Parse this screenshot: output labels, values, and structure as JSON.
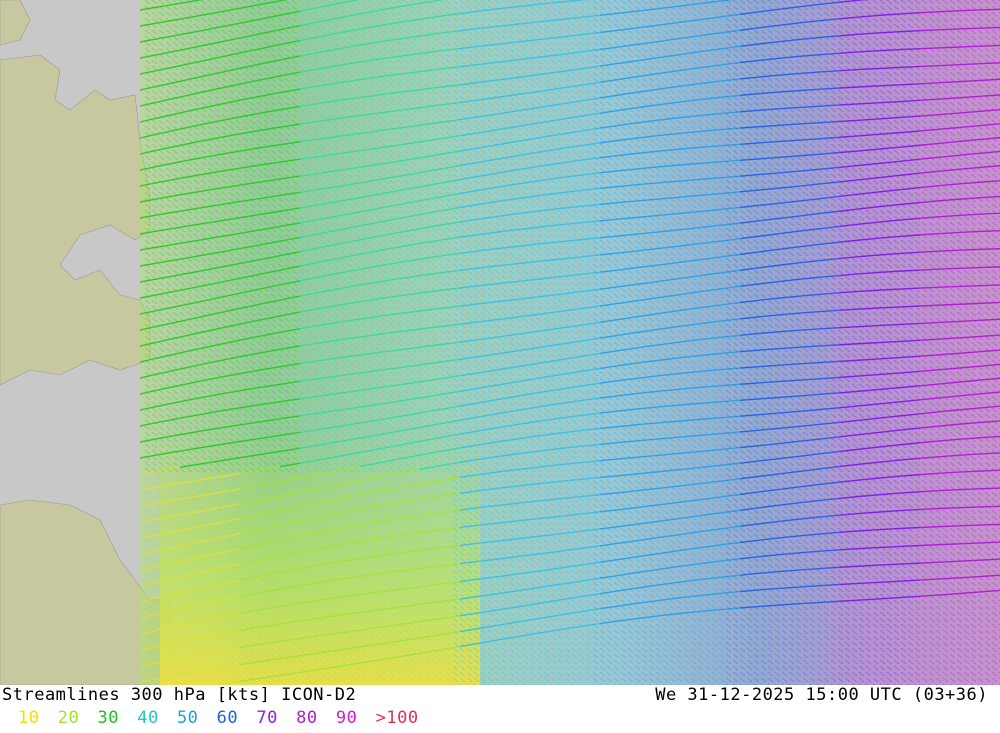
{
  "header": {
    "title": "Streamlines 300 hPa [kts] ICON-D2",
    "valid_time": "We 31-12-2025 15:00 UTC (03+36)"
  },
  "legend": [
    {
      "label": "10",
      "color": "#f0e000"
    },
    {
      "label": "20",
      "color": "#a0e030"
    },
    {
      "label": "30",
      "color": "#20c020"
    },
    {
      "label": "40",
      "color": "#20c8c0"
    },
    {
      "label": "50",
      "color": "#20a0e0"
    },
    {
      "label": "60",
      "color": "#2060e0"
    },
    {
      "label": "70",
      "color": "#9020e0"
    },
    {
      "label": "80",
      "color": "#b020c8"
    },
    {
      "label": "90",
      "color": "#d020d0"
    },
    {
      "label": ">100",
      "color": "#e03050"
    }
  ],
  "map": {
    "land_color": "#c8c8a0",
    "sea_color": "#c8c8c8",
    "wind_region_bg": "#ffffff",
    "streamline_direction": "west-to-east, slight northward tilt in east"
  }
}
